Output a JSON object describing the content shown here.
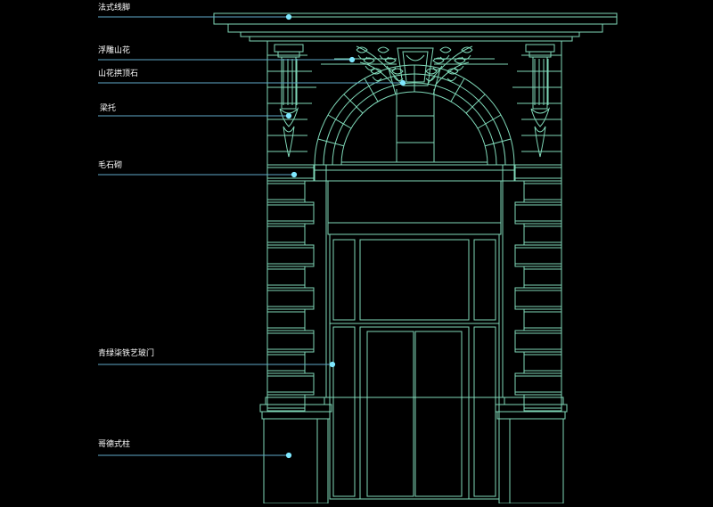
{
  "drawing": {
    "line_color": "#7fd8b8",
    "leader_color": "#5fa8c8",
    "dot_color": "#7fe8ff"
  },
  "labels": {
    "cornice": "法式线脚",
    "relief_carving": "浮雕山花",
    "keystone": "山花拱顶石",
    "bracket": "梁托",
    "rubble_masonry": "毛石砌",
    "iron_glass_door": "青绿柒铁艺玻门",
    "corinthian_column": "哥德式柱"
  }
}
